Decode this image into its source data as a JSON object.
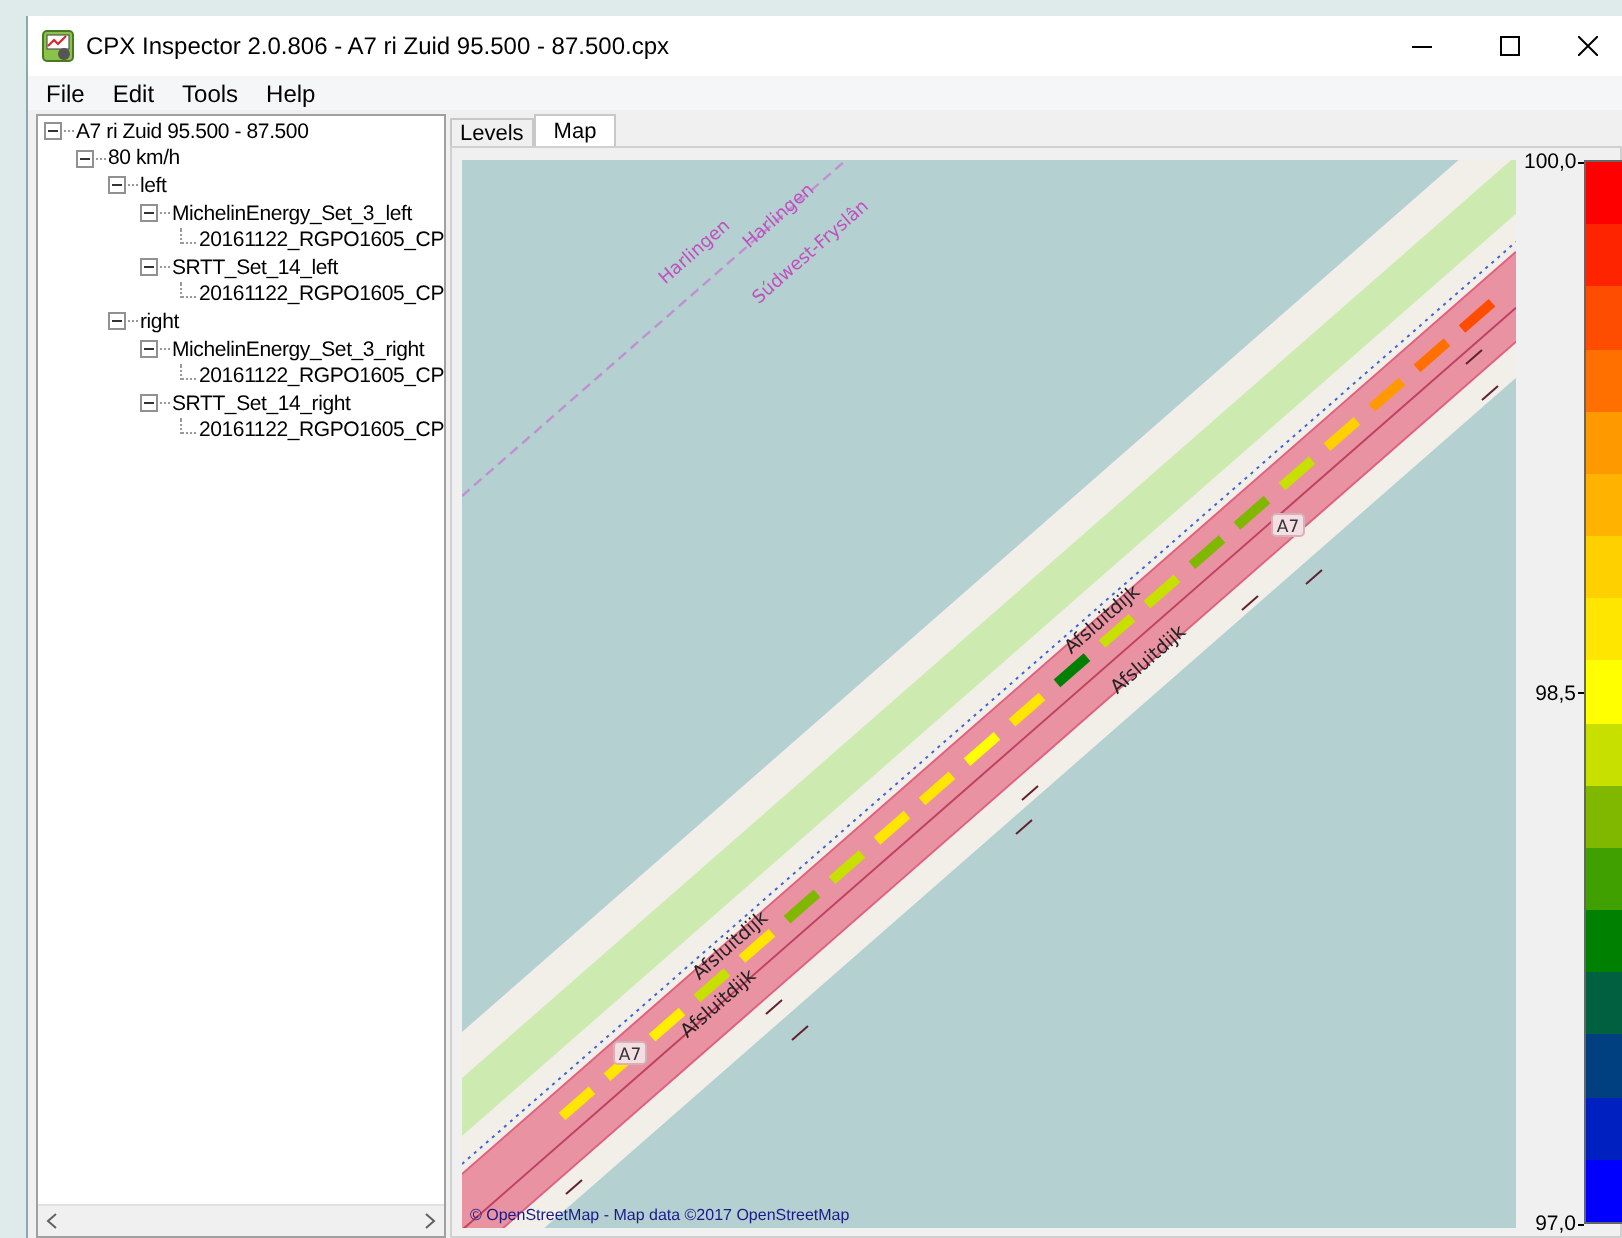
{
  "window": {
    "title": "CPX Inspector 2.0.806 - A7 ri Zuid 95.500 - 87.500.cpx"
  },
  "menu": [
    "File",
    "Edit",
    "Tools",
    "Help"
  ],
  "tree": [
    {
      "label": "A7 ri Zuid 95.500 - 87.500",
      "expanded": true,
      "children": [
        {
          "label": "80 km/h",
          "expanded": true,
          "children": [
            {
              "label": "left",
              "expanded": true,
              "children": [
                {
                  "label": "MichelinEnergy_Set_3_left",
                  "expanded": true,
                  "children": [
                    {
                      "label": "20161122_RGPO1605_CP"
                    }
                  ]
                },
                {
                  "label": "SRTT_Set_14_left",
                  "expanded": true,
                  "children": [
                    {
                      "label": "20161122_RGPO1605_CP"
                    }
                  ]
                }
              ]
            },
            {
              "label": "right",
              "expanded": true,
              "children": [
                {
                  "label": "MichelinEnergy_Set_3_right",
                  "expanded": true,
                  "children": [
                    {
                      "label": "20161122_RGPO1605_CP"
                    }
                  ]
                },
                {
                  "label": "SRTT_Set_14_right",
                  "expanded": true,
                  "children": [
                    {
                      "label": "20161122_RGPO1605_CP"
                    }
                  ]
                }
              ]
            }
          ]
        }
      ]
    }
  ],
  "tabs": [
    {
      "label": "Levels",
      "selected": false
    },
    {
      "label": "Map",
      "selected": true
    }
  ],
  "map": {
    "labels": [
      {
        "kind": "boundary",
        "text": "Harlingen"
      },
      {
        "kind": "boundary",
        "text": "Harlingen"
      },
      {
        "kind": "boundary",
        "text": "Súdwest-Fryslân"
      },
      {
        "kind": "road",
        "text": "Afsluitdijk"
      },
      {
        "kind": "road",
        "text": "Afsluitdijk"
      },
      {
        "kind": "road",
        "text": "Afsluitdijk"
      },
      {
        "kind": "road",
        "text": "Afsluitdijk"
      },
      {
        "kind": "shield",
        "text": "A7"
      },
      {
        "kind": "shield",
        "text": "A7"
      }
    ],
    "attribution": "© OpenStreetMap - Map data ©2017 OpenStreetMap"
  },
  "legend": {
    "ticks": [
      "100,0",
      "98,5",
      "97,0"
    ],
    "bands": [
      {
        "color": "#ff0000"
      },
      {
        "color": "#ff2400"
      },
      {
        "color": "#ff4d00"
      },
      {
        "color": "#ff7000"
      },
      {
        "color": "#ff9900"
      },
      {
        "color": "#ffb300"
      },
      {
        "color": "#ffd000"
      },
      {
        "color": "#ffe600"
      },
      {
        "color": "#ffff00"
      },
      {
        "color": "#c8e000"
      },
      {
        "color": "#80b800"
      },
      {
        "color": "#40a000"
      },
      {
        "color": "#008000"
      },
      {
        "color": "#006040"
      },
      {
        "color": "#004080"
      },
      {
        "color": "#0020c0"
      },
      {
        "color": "#0000ff"
      }
    ]
  }
}
